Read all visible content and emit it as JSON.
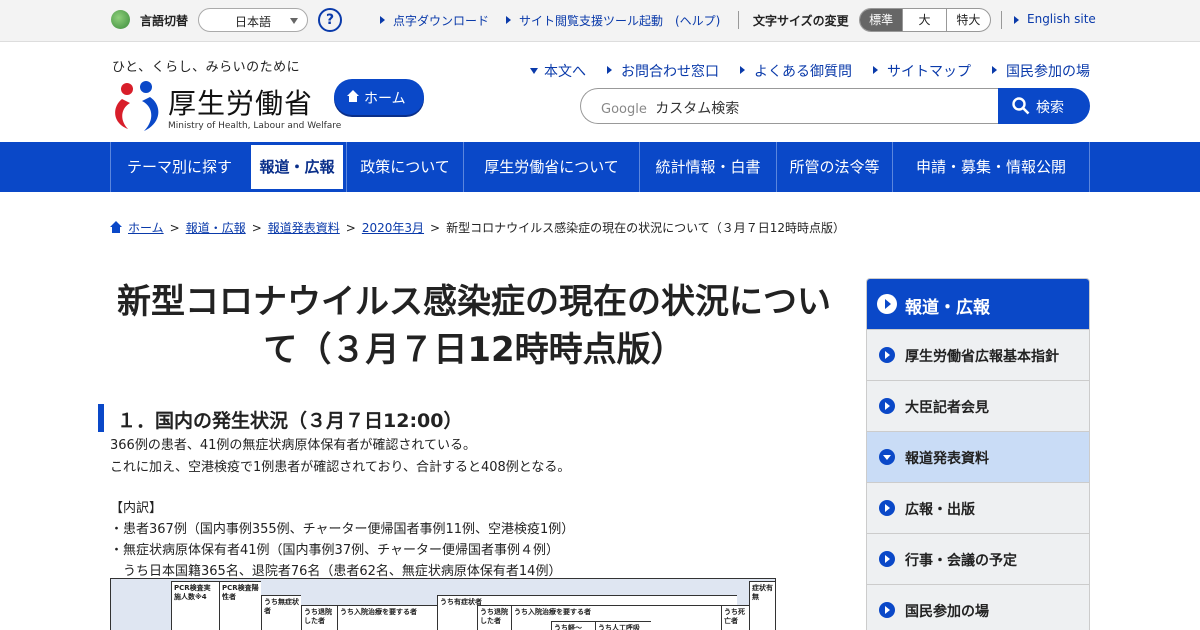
{
  "utility": {
    "lang_label": "言語切替",
    "lang_value": "日本語",
    "help_label": "?",
    "braille_link": "点字ダウンロード",
    "access_tool_link": "サイト閲覧支援ツール起動　(ヘルプ)",
    "font_size_label": "文字サイズの変更",
    "font_sizes": [
      "標準",
      "大",
      "特大"
    ],
    "english_link": "English site"
  },
  "header": {
    "tagline": "ひと、くらし、みらいのために",
    "logo_name": "厚生労働省",
    "logo_sub": "Ministry of Health, Labour and Welfare",
    "home_button": "ホーム",
    "links": [
      "本文へ",
      "お問合わせ窓口",
      "よくある御質問",
      "サイトマップ",
      "国民参加の場"
    ],
    "search_brand": "Google",
    "search_placeholder": "カスタム検索",
    "search_button": "検索"
  },
  "gnav": [
    "テーマ別に探す",
    "報道・広報",
    "政策について",
    "厚生労働省について",
    "統計情報・白書",
    "所管の法令等",
    "申請・募集・情報公開"
  ],
  "breadcrumb": {
    "items": [
      "ホーム",
      "報道・広報",
      "報道発表資料",
      "2020年3月"
    ],
    "current": "新型コロナウイルス感染症の現在の状況について（３月７日12時時点版）"
  },
  "page": {
    "title": "新型コロナウイルス感染症の現在の状況について（３月７日12時時点版）",
    "section_heading": "１．国内の発生状況（３月７日12:00）",
    "lines": [
      "366例の患者、41例の無症状病原体保有者が確認されている。",
      "これに加え、空港検疫で1例患者が確認されており、合計すると408例となる。",
      "【内訳】",
      "・患者367例（国内事例355例、チャーター便帰国者事例11例、空港検疫1例）",
      "・無症状病原体保有者41例（国内事例37例、チャーター便帰国者事例４例）",
      "　うち日本国籍365名、退院者76名（患者62名、無症状病原体保有者14例）"
    ],
    "table_headers": [
      "PCR検査実施人数※4",
      "PCR検査陽性者",
      "うち無症状者",
      "うち退院した者",
      "うち入院治療を要する者",
      "うち有症状者",
      "うち退院した者",
      "うち入院治療を要する者",
      "うち軽～",
      "うち人工呼吸",
      "うち死亡者",
      "症状有無"
    ]
  },
  "sidebar": {
    "title": "報道・広報",
    "items": [
      "厚生労働省広報基本指針",
      "大臣記者会見",
      "報道発表資料",
      "広報・出版",
      "行事・会議の予定",
      "国民参加の場"
    ],
    "current_index": 2
  },
  "colors": {
    "brand_blue": "#0a48c8",
    "link_blue": "#0a3aaa",
    "sidebar_current": "#c9dcf6"
  }
}
